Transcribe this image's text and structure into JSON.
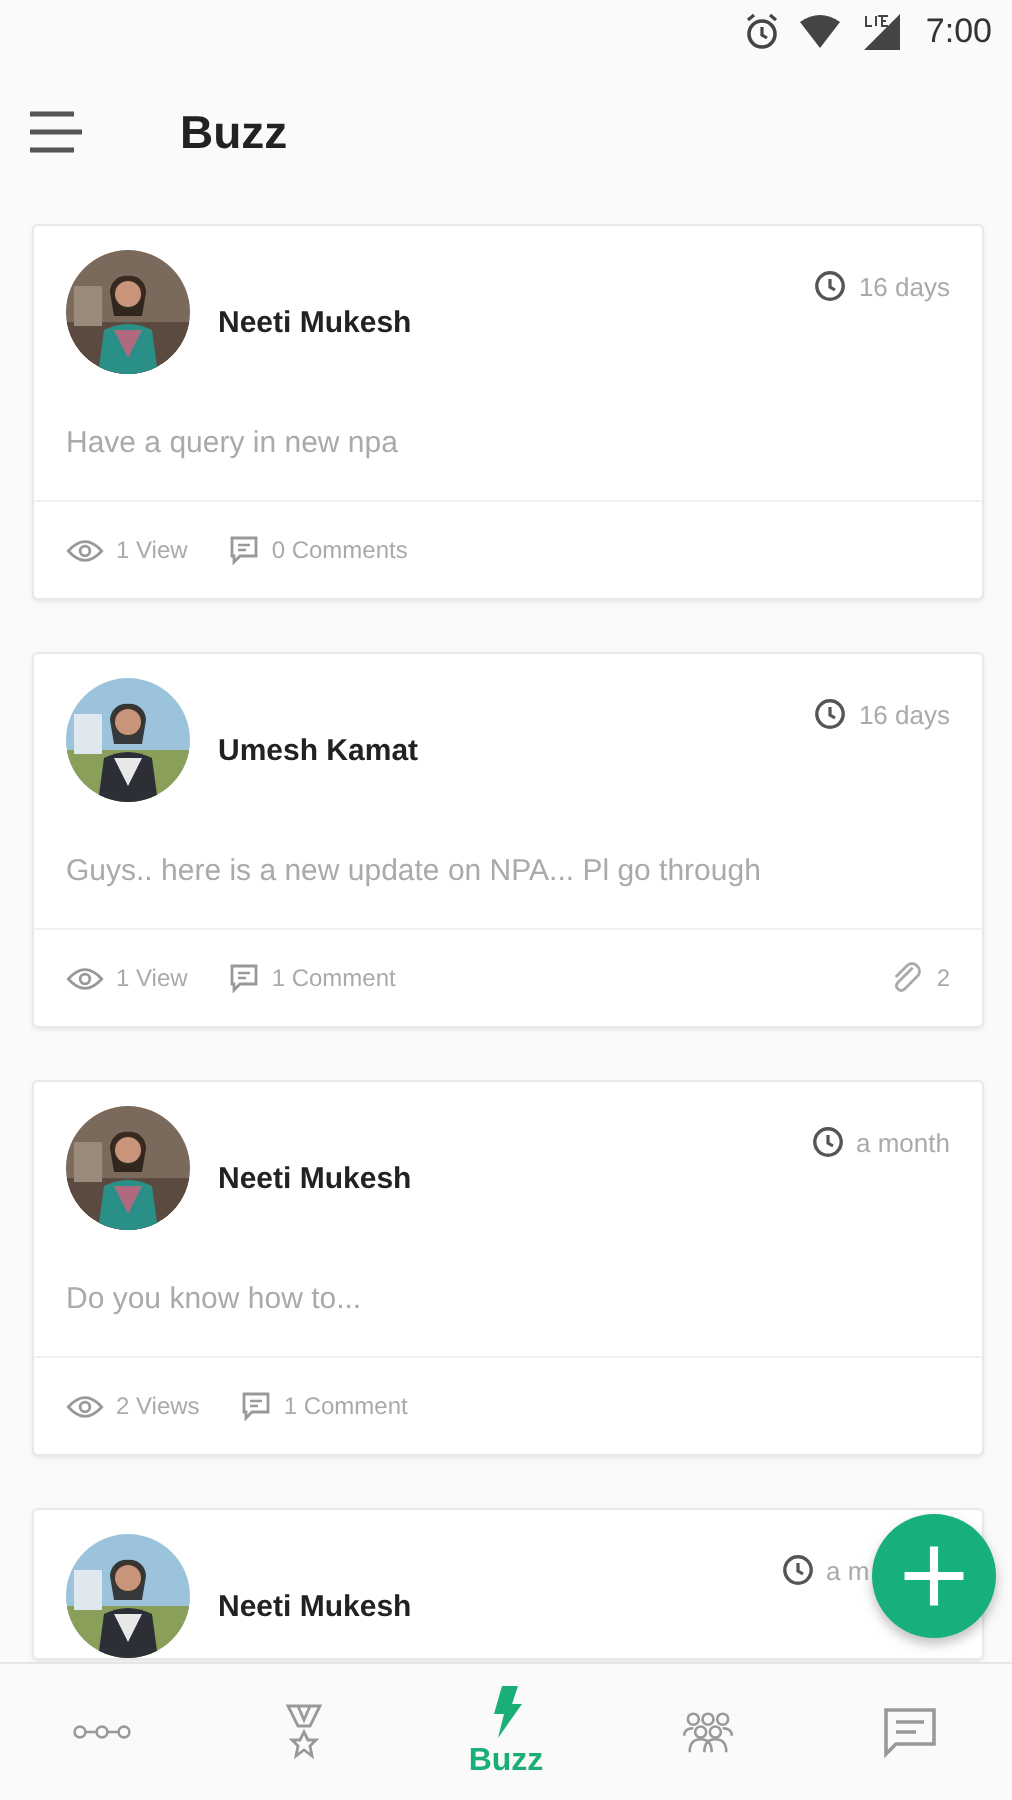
{
  "status_bar": {
    "time": "7:00"
  },
  "header": {
    "title": "Buzz"
  },
  "posts": [
    {
      "author": "Neeti Mukesh",
      "time": "16 days",
      "message": "Have a query in new npa",
      "views": "1 View",
      "comments": "0 Comments"
    },
    {
      "author": "Umesh  Kamat",
      "time": "16 days",
      "message": "Guys.. here is a new update on NPA... Pl go through",
      "views": "1 View",
      "comments": "1 Comment",
      "attachments": "2"
    },
    {
      "author": "Neeti Mukesh",
      "time": "a month",
      "message": "Do you know how to...",
      "views": "2 Views",
      "comments": "1 Comment"
    },
    {
      "author": "Neeti Mukesh",
      "time": "a m"
    }
  ],
  "bottom_nav": [
    {
      "kind": "dots",
      "selected": false
    },
    {
      "kind": "medal",
      "selected": false
    },
    {
      "kind": "bolt",
      "label": "Buzz",
      "selected": true
    },
    {
      "kind": "people",
      "selected": false
    },
    {
      "kind": "chat",
      "selected": false
    }
  ]
}
